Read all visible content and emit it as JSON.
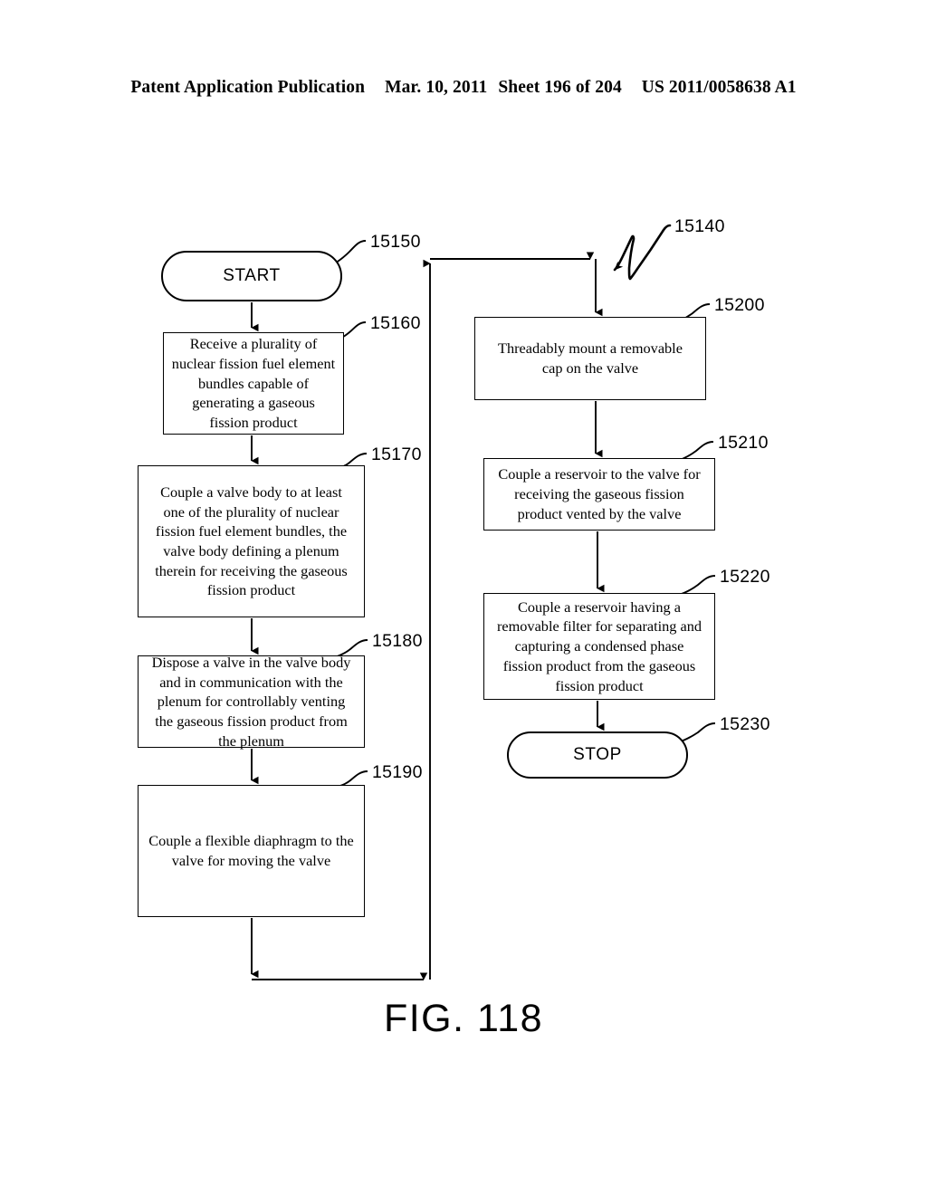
{
  "header": {
    "publication": "Patent Application Publication",
    "date": "Mar. 10, 2011",
    "sheet": "Sheet 196 of 204",
    "patent_number": "US 2011/0058638 A1"
  },
  "figure": {
    "caption": "FIG. 118",
    "overall_ref": "15140"
  },
  "nodes": {
    "start": {
      "label": "START",
      "ref": "15150"
    },
    "step_15160": {
      "ref": "15160",
      "text": "Receive a plurality of\nnuclear fission fuel element\nbundles capable of\ngenerating a gaseous\nfission product"
    },
    "step_15170": {
      "ref": "15170",
      "text": "Couple a valve body to at least\none of the plurality of nuclear\nfission fuel element bundles, the\nvalve body defining a plenum\ntherein for receiving the gaseous\nfission product"
    },
    "step_15180": {
      "ref": "15180",
      "text": "Dispose a valve in the valve body\nand in communication with the\nplenum for controllably venting\nthe gaseous fission product from\nthe plenum"
    },
    "step_15190": {
      "ref": "15190",
      "text": "Couple a flexible diaphragm to the\nvalve for moving the valve"
    },
    "step_15200": {
      "ref": "15200",
      "text": "Threadably mount a removable\ncap on the valve"
    },
    "step_15210": {
      "ref": "15210",
      "text": "Couple a reservoir to the valve for\nreceiving the gaseous fission\nproduct vented by the valve"
    },
    "step_15220": {
      "ref": "15220",
      "text": "Couple a reservoir having a\nremovable filter for separating and\ncapturing a condensed phase\nfission product from the gaseous\nfission product"
    },
    "stop": {
      "label": "STOP",
      "ref": "15230"
    }
  },
  "colors": {
    "ink": "#000000",
    "paper": "#ffffff"
  }
}
